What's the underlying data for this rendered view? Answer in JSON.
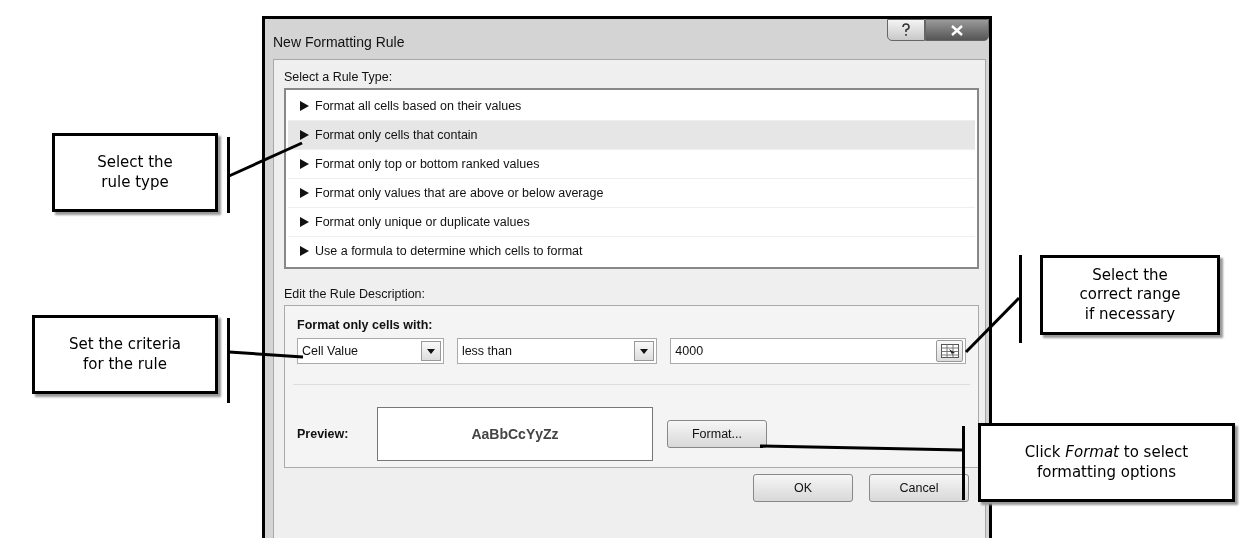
{
  "dialog": {
    "title": "New Formatting Rule",
    "rule_type_label": "Select a Rule Type:",
    "rule_types": [
      {
        "label": "Format all cells based on their values",
        "selected": false
      },
      {
        "label": "Format only cells that contain",
        "selected": true
      },
      {
        "label": "Format only top or bottom ranked values",
        "selected": false
      },
      {
        "label": "Format only values that are above or below average",
        "selected": false
      },
      {
        "label": "Format only unique or duplicate values",
        "selected": false
      },
      {
        "label": "Use a formula to determine which cells to format",
        "selected": false
      }
    ],
    "description_label": "Edit the Rule Description:",
    "condition_heading": "Format only cells with:",
    "condition_fields": [
      {
        "kind": "dropdown",
        "value": "Cell Value"
      },
      {
        "kind": "dropdown",
        "value": "less than"
      },
      {
        "kind": "range",
        "value": "4000"
      }
    ],
    "preview_label": "Preview:",
    "preview_text": "AaBbCcYyZz",
    "format_button": "Format...",
    "buttons": [
      "OK",
      "Cancel"
    ]
  },
  "callouts": [
    {
      "text": "Select the\nrule type"
    },
    {
      "text": "Set the criteria\nfor the rule"
    },
    {
      "text": "Select the\ncorrect range\nif necessary"
    },
    {
      "text": "Click *Format* to select\nformatting options"
    }
  ]
}
